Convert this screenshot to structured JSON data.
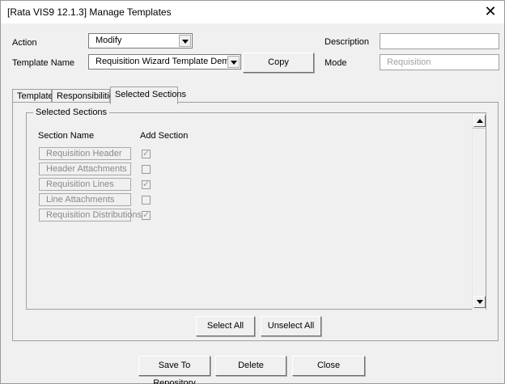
{
  "window": {
    "title": "[Rata VIS9 12.1.3] Manage Templates",
    "close_glyph": "✕"
  },
  "form": {
    "action_label": "Action",
    "action_value": "Modify",
    "template_name_label": "Template Name",
    "template_name_value": "Requisition Wizard Template Demo",
    "copy_button": "Copy",
    "description_label": "Description",
    "description_value": "",
    "mode_label": "Mode",
    "mode_placeholder": "Requisition"
  },
  "tabs": [
    {
      "label": "Template",
      "active": false
    },
    {
      "label": "Responsibilities",
      "active": false
    },
    {
      "label": "Selected Sections",
      "active": true
    }
  ],
  "selected_sections": {
    "group_title": "Selected Sections",
    "col_section_name": "Section Name",
    "col_add_section": "Add Section",
    "rows": [
      {
        "name": "Requisition Header",
        "checked": true
      },
      {
        "name": "Header Attachments",
        "checked": false
      },
      {
        "name": "Requisition Lines",
        "checked": true
      },
      {
        "name": "Line Attachments",
        "checked": false
      },
      {
        "name": "Requisition Distributions",
        "checked": true
      }
    ]
  },
  "panel_buttons": {
    "select_all": "Select All",
    "unselect_all": "Unselect All"
  },
  "footer_buttons": {
    "save": "Save To Repository",
    "delete": "Delete",
    "close": "Close"
  },
  "colors": {
    "window_bg": "#f0f0f0",
    "disabled_text": "#8a8a8a"
  }
}
